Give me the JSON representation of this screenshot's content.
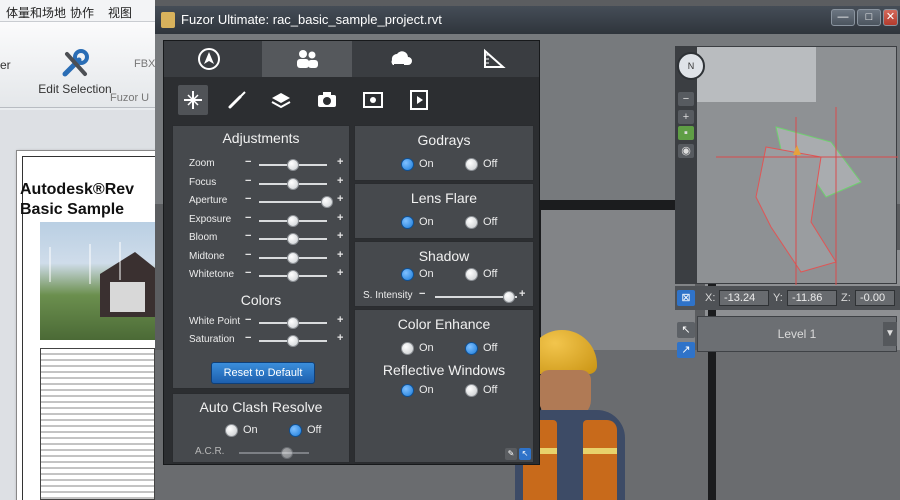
{
  "host": {
    "menu": [
      "体量和场地",
      "协作",
      "视图"
    ],
    "edit_selection_label": "Edit Selection",
    "left_cut_label": "er",
    "fbx_label": "FBX",
    "panel_label": "Fuzor U",
    "sheet_title_line1": "Autodesk®Rev",
    "sheet_title_line2": "Basic Sample"
  },
  "window": {
    "title": "Fuzor Ultimate: rac_basic_sample_project.rvt",
    "min": "—",
    "max": "□",
    "close": "✕"
  },
  "tabs": [
    {
      "icon": "navigation-icon",
      "active": false
    },
    {
      "icon": "people-icon",
      "active": true
    },
    {
      "icon": "cloud-icon",
      "active": false
    },
    {
      "icon": "ruler-icon",
      "active": false
    }
  ],
  "subtabs": [
    {
      "icon": "directional-icon",
      "active": true
    },
    {
      "icon": "brush-icon",
      "active": false
    },
    {
      "icon": "layers-icon",
      "active": false
    },
    {
      "icon": "camera-icon",
      "active": false
    },
    {
      "icon": "screenshot-icon",
      "active": false
    },
    {
      "icon": "video-icon",
      "active": false
    }
  ],
  "adjustments": {
    "title": "Adjustments",
    "sliders": [
      {
        "label": "Zoom",
        "value": 0.5
      },
      {
        "label": "Focus",
        "value": 0.5
      },
      {
        "label": "Aperture",
        "value": 1.0
      },
      {
        "label": "Exposure",
        "value": 0.5
      },
      {
        "label": "Bloom",
        "value": 0.5
      },
      {
        "label": "Midtone",
        "value": 0.5
      },
      {
        "label": "Whitetone",
        "value": 0.5
      }
    ]
  },
  "colors": {
    "title": "Colors",
    "sliders": [
      {
        "label": "White Point",
        "value": 0.5
      },
      {
        "label": "Saturation",
        "value": 0.5
      }
    ],
    "reset_label": "Reset to Default"
  },
  "clash": {
    "title": "Auto Clash Resolve",
    "on_label": "On",
    "off_label": "Off",
    "selected": "off",
    "acr_label": "A.C.R.",
    "acr_value": 0.5
  },
  "godrays": {
    "title": "Godrays",
    "on_label": "On",
    "off_label": "Off",
    "selected": "on"
  },
  "lens_flare": {
    "title": "Lens Flare",
    "on_label": "On",
    "off_label": "Off",
    "selected": "on"
  },
  "shadow": {
    "title": "Shadow",
    "on_label": "On",
    "off_label": "Off",
    "selected": "on",
    "intensity_label": "S. Intensity",
    "intensity_value": 0.9
  },
  "color_enhance": {
    "title": "Color Enhance",
    "on_label": "On",
    "off_label": "Off",
    "selected": "off"
  },
  "reflective": {
    "title": "Reflective Windows",
    "on_label": "On",
    "off_label": "Off",
    "selected": "on"
  },
  "coords": {
    "x_label": "X:",
    "x": "-13.24",
    "y_label": "Y:",
    "y": "-11.86",
    "z_label": "Z:",
    "z": "-0.00"
  },
  "level_select": "Level 1",
  "colors_palette": {
    "accent": "#1b7bd9",
    "panel": "#46494d",
    "tab_active": "#55585c"
  }
}
